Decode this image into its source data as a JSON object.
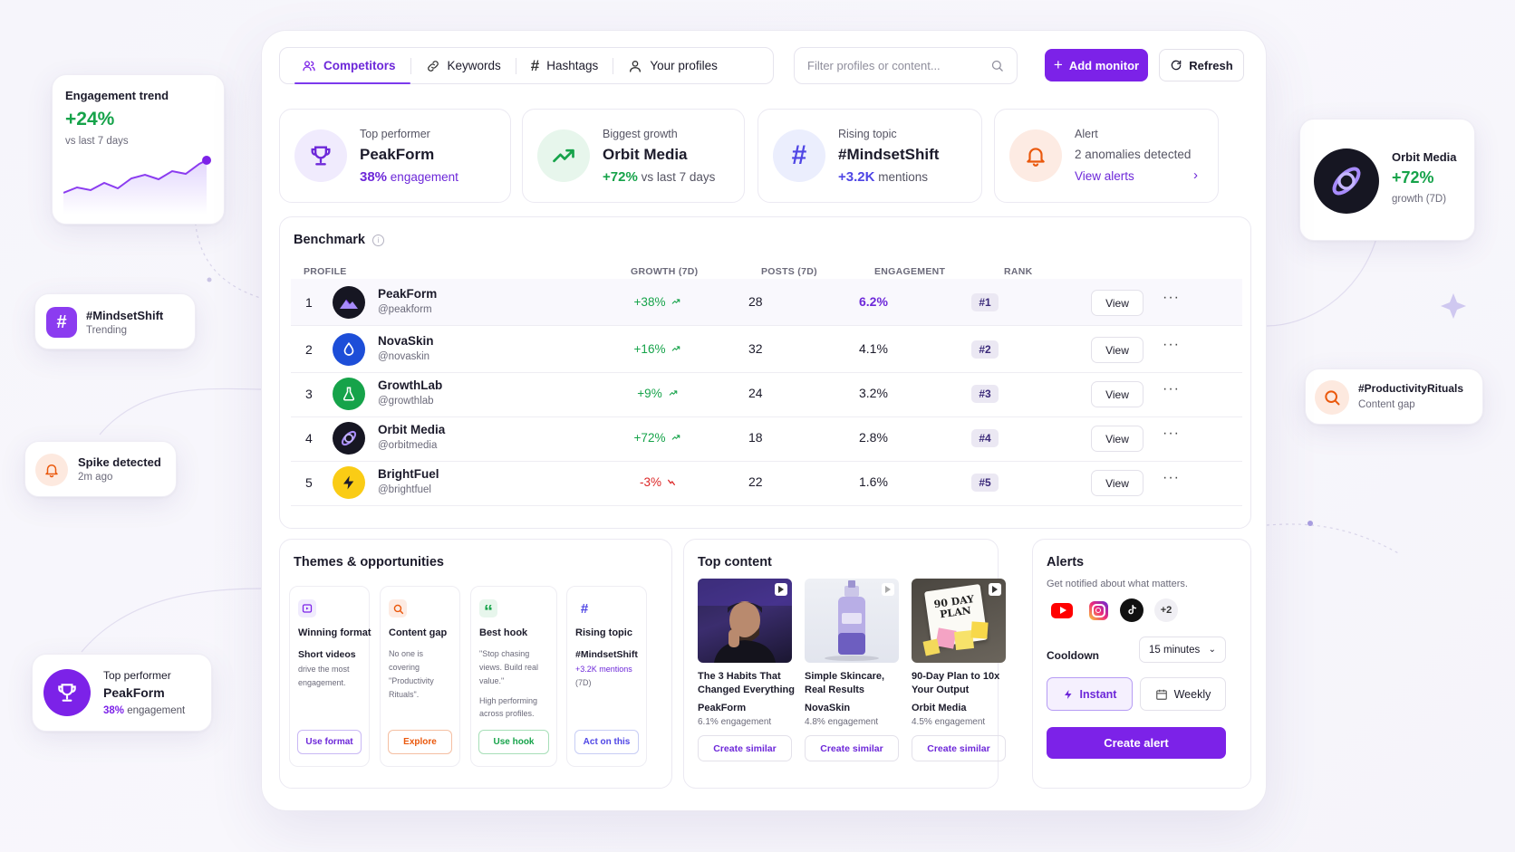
{
  "float": {
    "engagement_trend": {
      "title": "Engagement trend",
      "value": "+24%",
      "sub": "vs last 7 days"
    },
    "mindset": {
      "title": "#MindsetShift",
      "sub": "Trending"
    },
    "spike": {
      "title": "Spike detected",
      "sub": "2m ago"
    },
    "top_performer": {
      "label": "Top performer",
      "name": "PeakForm",
      "pct": "38%",
      "suffix": "engagement"
    },
    "orbit": {
      "name": "Orbit Media",
      "value": "+72%",
      "sub": "growth (7D)"
    },
    "productivity": {
      "title": "#ProductivityRituals",
      "sub": "Content gap"
    }
  },
  "tabs": [
    {
      "label": "Competitors",
      "icon": "users-icon"
    },
    {
      "label": "Keywords",
      "icon": "link-icon"
    },
    {
      "label": "Hashtags",
      "icon": "hash-icon"
    },
    {
      "label": "Your profiles",
      "icon": "user-icon"
    }
  ],
  "search": {
    "placeholder": "Filter profiles or content..."
  },
  "buttons": {
    "add_monitor": "Add monitor",
    "refresh": "Refresh"
  },
  "stats": [
    {
      "label": "Top performer",
      "value": "PeakForm",
      "highlight": "38%",
      "rest": "engagement"
    },
    {
      "label": "Biggest growth",
      "value": "Orbit Media",
      "highlight": "+72%",
      "rest": "vs last 7 days"
    },
    {
      "label": "Rising topic",
      "value": "#MindsetShift",
      "highlight": "+3.2K",
      "rest": "mentions"
    },
    {
      "label": "Alert",
      "value": "2 anomalies detected",
      "link": "View alerts"
    }
  ],
  "benchmark": {
    "title": "Benchmark",
    "headers": {
      "profile": "PROFILE",
      "growth": "GROWTH (7D)",
      "posts": "POSTS (7D)",
      "engagement": "ENGAGEMENT",
      "rank": "RANK"
    },
    "view_label": "View",
    "rows": [
      {
        "n": "1",
        "name": "PeakForm",
        "handle": "@peakform",
        "growth": "+38%",
        "posts": "28",
        "engagement": "6.2%",
        "rank": "#1"
      },
      {
        "n": "2",
        "name": "NovaSkin",
        "handle": "@novaskin",
        "growth": "+16%",
        "posts": "32",
        "engagement": "4.1%",
        "rank": "#2"
      },
      {
        "n": "3",
        "name": "GrowthLab",
        "handle": "@growthlab",
        "growth": "+9%",
        "posts": "24",
        "engagement": "3.2%",
        "rank": "#3"
      },
      {
        "n": "4",
        "name": "Orbit Media",
        "handle": "@orbitmedia",
        "growth": "+72%",
        "posts": "18",
        "engagement": "2.8%",
        "rank": "#4"
      },
      {
        "n": "5",
        "name": "BrightFuel",
        "handle": "@brightfuel",
        "growth": "-3%",
        "posts": "22",
        "engagement": "1.6%",
        "rank": "#5"
      }
    ]
  },
  "themes": {
    "title": "Themes & opportunities",
    "cards": [
      {
        "title": "Winning format",
        "strong": "Short videos",
        "body": "drive the most engagement.",
        "button": "Use format"
      },
      {
        "title": "Content gap",
        "body": "No one is covering \"Productivity Rituals\".",
        "button": "Explore"
      },
      {
        "title": "Best hook",
        "body": "\"Stop chasing views. Build real value.\"",
        "body2": "High performing across profiles.",
        "button": "Use hook"
      },
      {
        "title": "Rising topic",
        "strong": "#MindsetShift",
        "highlight": "+3.2K mentions",
        "body": "(7D)",
        "button": "Act on this"
      }
    ]
  },
  "top_content": {
    "title": "Top content",
    "button": "Create similar",
    "items": [
      {
        "title": "The 3 Habits That Changed Everything",
        "brand": "PeakForm",
        "eng": "6.1% engagement"
      },
      {
        "title": "Simple Skincare, Real Results",
        "brand": "NovaSkin",
        "eng": "4.8% engagement"
      },
      {
        "title": "90-Day Plan to 10x Your Output",
        "brand": "Orbit Media",
        "eng": "4.5% engagement",
        "note": "90 DAY PLAN"
      }
    ]
  },
  "alerts": {
    "title": "Alerts",
    "sub": "Get notified about what matters.",
    "more": "+2",
    "cooldown_label": "Cooldown",
    "cooldown_value": "15 minutes",
    "instant": "Instant",
    "weekly": "Weekly",
    "create": "Create alert"
  }
}
